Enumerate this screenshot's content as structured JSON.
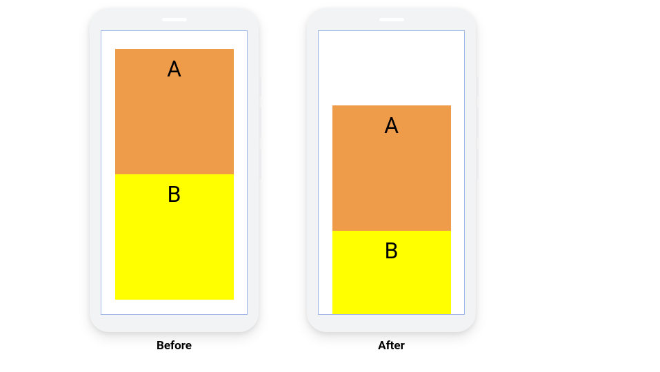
{
  "diagram": {
    "phones": [
      {
        "id": "before",
        "caption": "Before",
        "blocks": {
          "a": "A",
          "b": "B"
        }
      },
      {
        "id": "after",
        "caption": "After",
        "blocks": {
          "a": "A",
          "b": "B"
        }
      }
    ],
    "colors": {
      "block_a": "#ef9c4a",
      "block_b": "#ffff00",
      "phone_body": "#f2f3f4",
      "screen_border": "#9fb8e8",
      "background": "#ffffff"
    }
  }
}
